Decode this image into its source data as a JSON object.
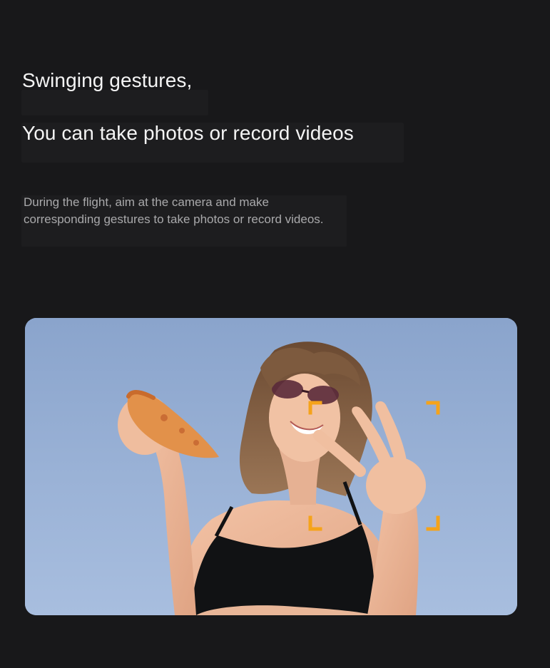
{
  "headline": {
    "line1": "Swinging gestures,",
    "line2": "You can take photos or record videos"
  },
  "description": "During the flight, aim at the camera and make corresponding gestures to take photos or record videos.",
  "photo": {
    "subject": "woman holding pizza slice making peace sign",
    "focus_frame_color": "#f5a31a"
  },
  "colors": {
    "background": "#18181a",
    "headline": "#f4f4f4",
    "description": "#a9a9ab",
    "accent": "#f5a31a"
  }
}
